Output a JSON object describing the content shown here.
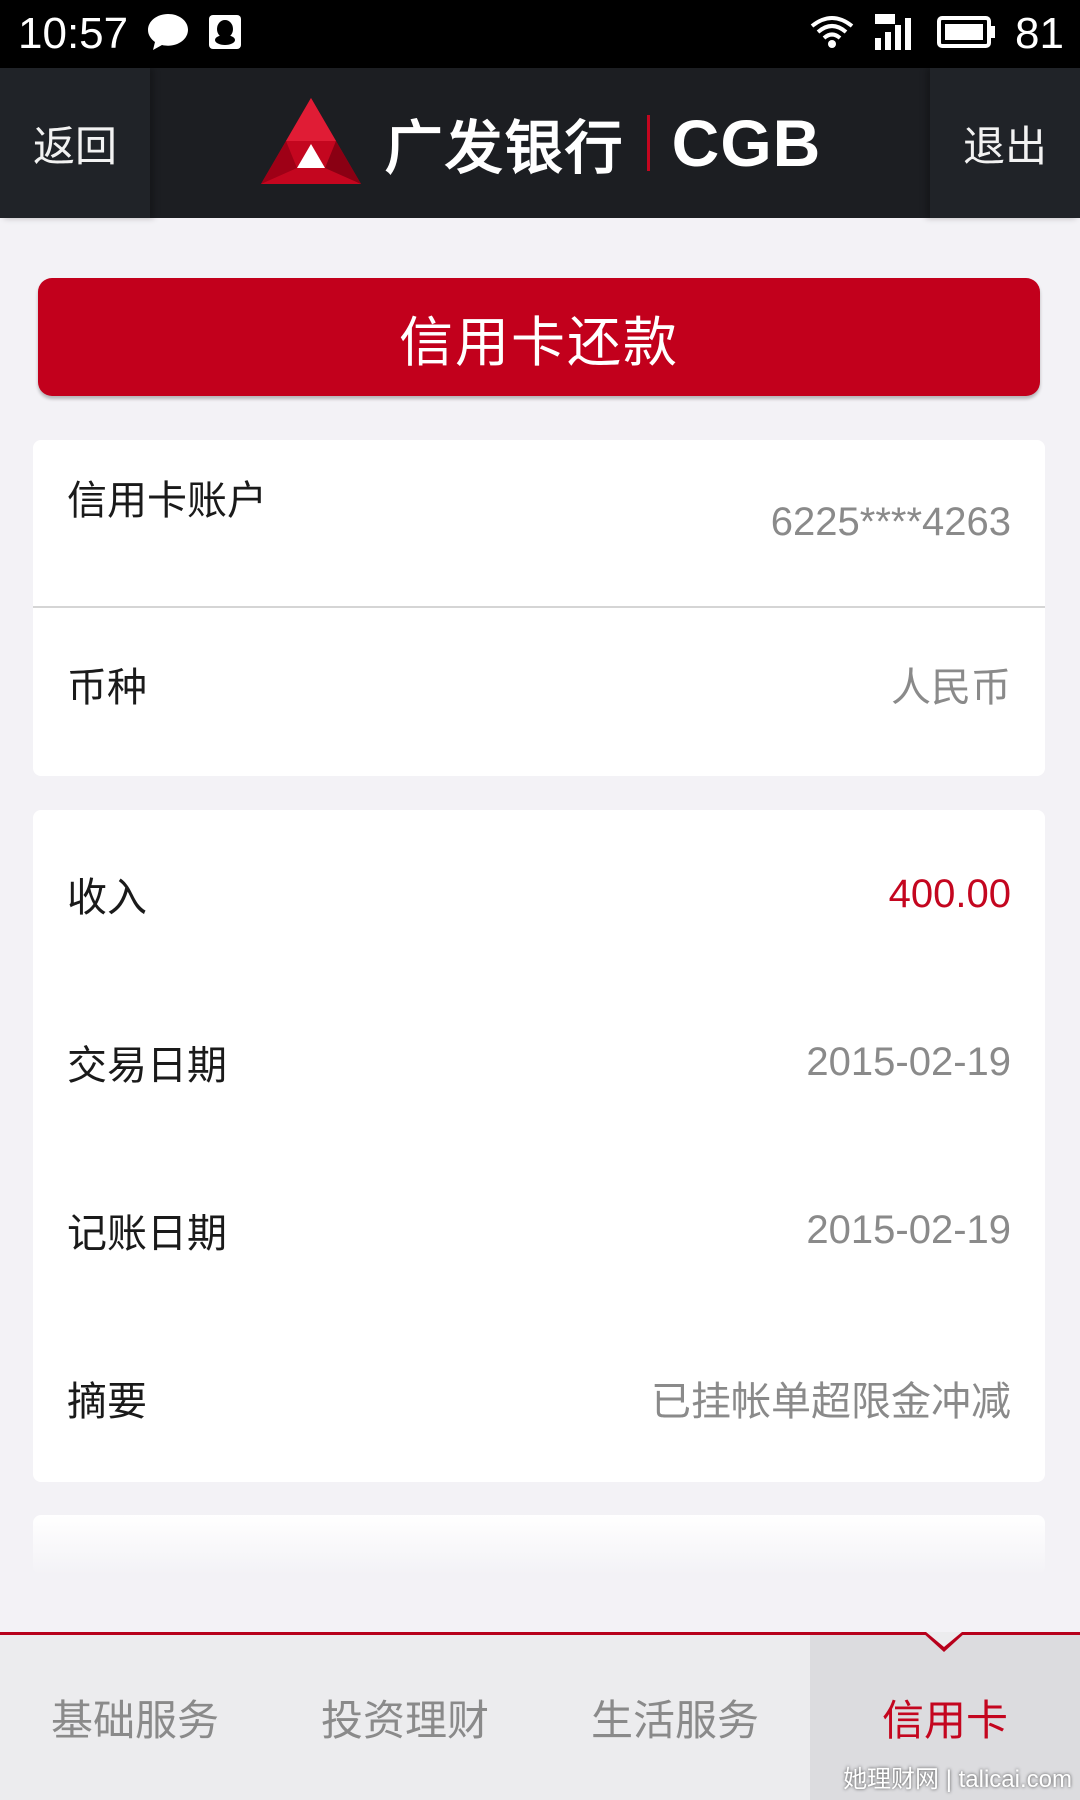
{
  "status_bar": {
    "time": "10:57",
    "battery": "81"
  },
  "nav": {
    "back_label": "返回",
    "brand_name": "广发银行",
    "brand_abbr": "CGB",
    "logout_label": "退出"
  },
  "page": {
    "title": "信用卡还款"
  },
  "account_card": {
    "rows": [
      {
        "label": "信用卡账户",
        "value": "6225****4263"
      },
      {
        "label": "币种",
        "value": "人民币"
      }
    ]
  },
  "detail_card": {
    "rows": [
      {
        "label": "收入",
        "value": "400.00"
      },
      {
        "label": "交易日期",
        "value": "2015-02-19"
      },
      {
        "label": "记账日期",
        "value": "2015-02-19"
      },
      {
        "label": "摘要",
        "value": "已挂帐单超限金冲减"
      }
    ]
  },
  "tabs": [
    {
      "label": "基础服务"
    },
    {
      "label": "投资理财"
    },
    {
      "label": "生活服务"
    },
    {
      "label": "信用卡"
    }
  ],
  "watermark": "她理财网 | talicai.com",
  "colors": {
    "brand_red": "#c2001c",
    "nav_bg": "#1c1e22",
    "page_bg": "#f3f2f6"
  }
}
